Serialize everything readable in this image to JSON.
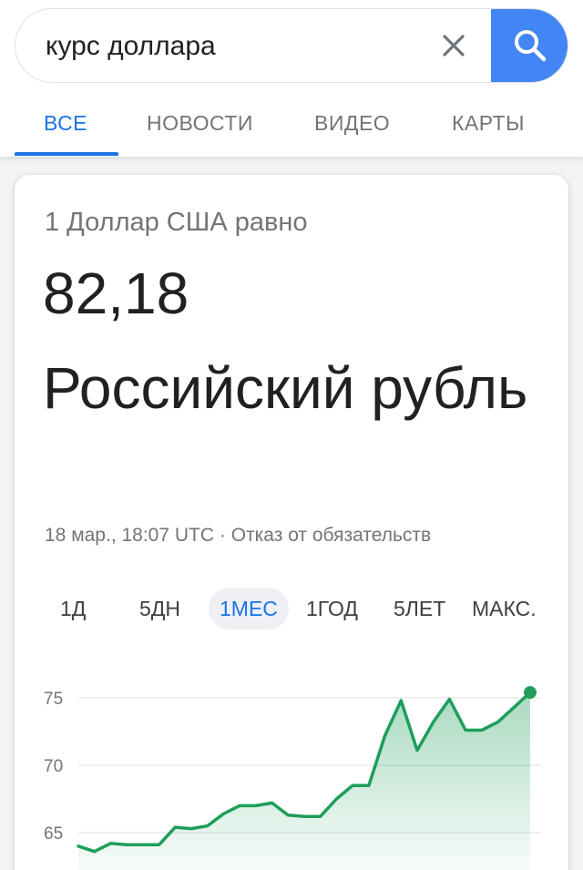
{
  "search": {
    "query": "курс доллара"
  },
  "tabs": [
    {
      "label": "ВСЕ"
    },
    {
      "label": "НОВОСТИ"
    },
    {
      "label": "ВИДЕО"
    },
    {
      "label": "КАРТЫ"
    }
  ],
  "converter": {
    "from_line": "1 Доллар США равно",
    "rate": "82,18",
    "currency": "Российский рубль",
    "meta": "18 мар., 18:07 UTC · Отказ от обязательств"
  },
  "ranges": [
    {
      "label": "1Д"
    },
    {
      "label": "5ДН"
    },
    {
      "label": "1МЕС"
    },
    {
      "label": "1ГОД"
    },
    {
      "label": "5ЛЕТ"
    },
    {
      "label": "МАКС."
    }
  ],
  "colors": {
    "accent": "#1a73e8",
    "search_button": "#4285f4",
    "series": "#1e9e5a"
  },
  "chart_data": {
    "type": "area",
    "y_ticks": [
      "75",
      "70",
      "65"
    ],
    "ylim": [
      62,
      77
    ],
    "grid": true,
    "series": [
      {
        "values": [
          64.0,
          63.6,
          64.2,
          64.1,
          64.1,
          64.1,
          65.4,
          65.3,
          65.5,
          66.4,
          67.0,
          67.0,
          67.2,
          66.3,
          66.2,
          66.2,
          67.5,
          68.5,
          68.5,
          72.2,
          74.8,
          71.1,
          73.2,
          74.9,
          72.6,
          72.6,
          73.2,
          74.3,
          75.4
        ]
      }
    ]
  }
}
